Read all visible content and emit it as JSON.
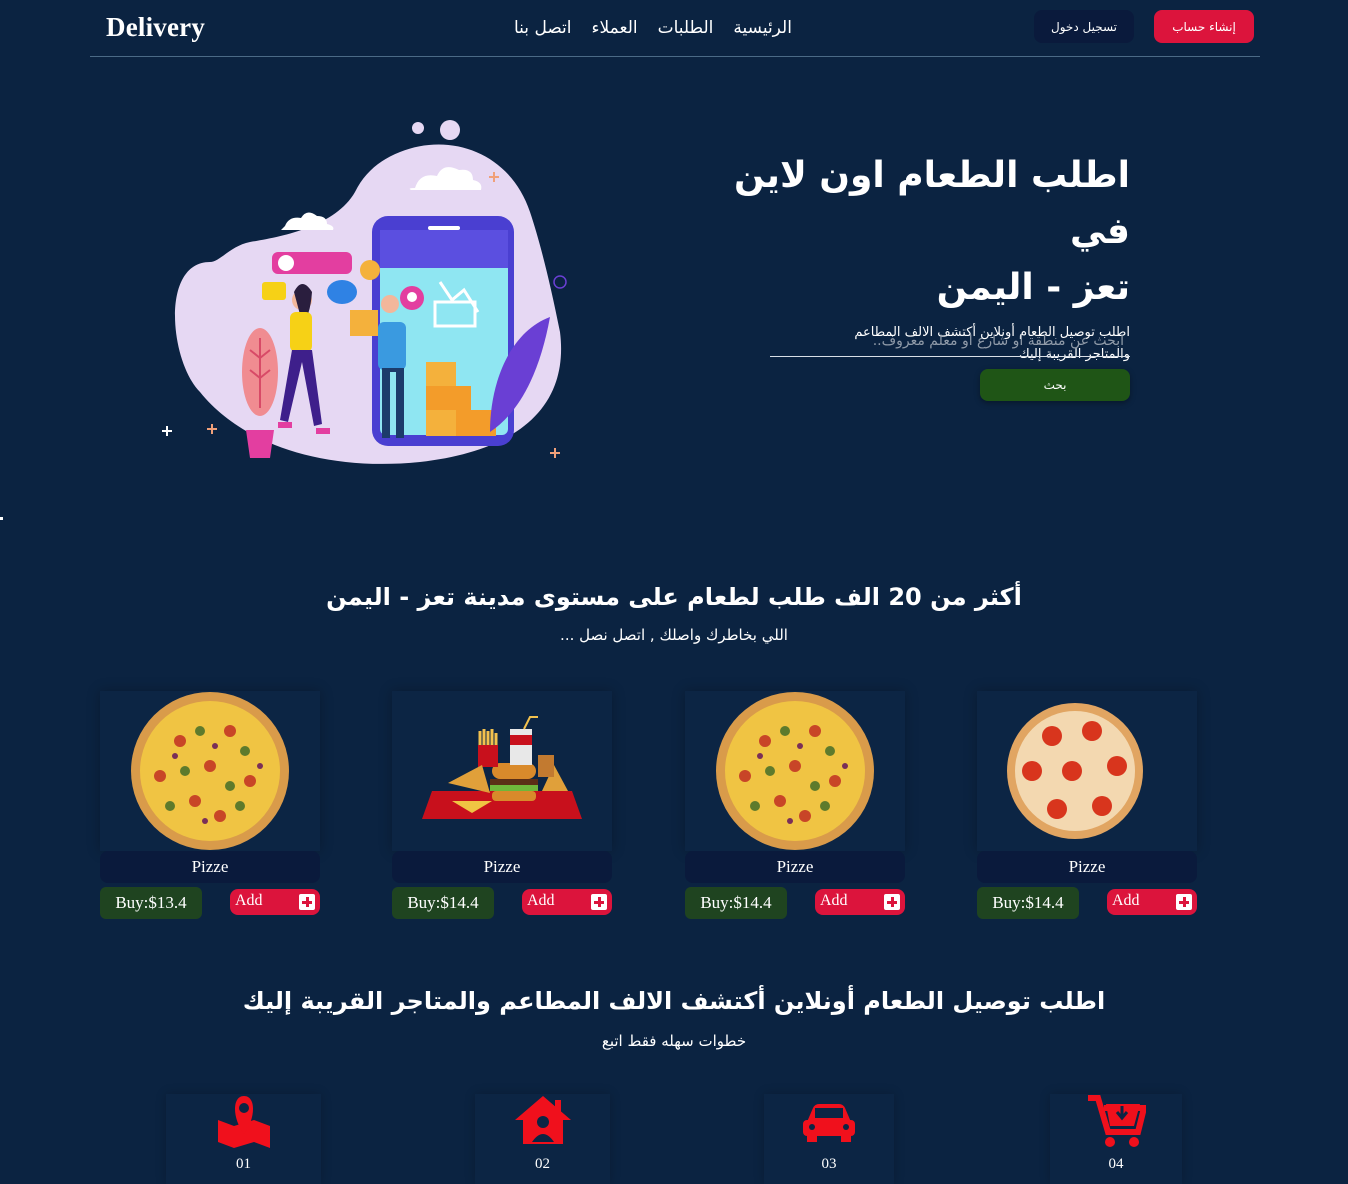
{
  "header": {
    "logo": "Delivery",
    "nav_links": [
      "الرئيسية",
      "الطلبات",
      "العملاء",
      "اتصل بنا"
    ],
    "login_label": "تسجيل دخول",
    "register_label": "إنشاء حساب"
  },
  "hero": {
    "title_line1": "اطلب الطعام اون لاين في",
    "title_line2": "تعز - اليمن",
    "subtitle_line1": "اطلب توصيل الطعام أونلاين أكتشف الالف المطاعم",
    "subtitle_line2": "والمتاجر القريبة إليك",
    "search_placeholder": "ابحث عن منطقة او شارع او معلم معروف..",
    "search_button": "بحث"
  },
  "products_section": {
    "title": "أكثر من 20 الف طلب لطعام على مستوى مدينة تعز - اليمن",
    "subtitle": "اللي بخاطرك واصلك , اتصل نصل ..."
  },
  "products": [
    {
      "name": "Pizze",
      "price": "Buy:$13.4",
      "add_label": "Add",
      "image": "veggie-pizza"
    },
    {
      "name": "Pizze",
      "price": "Buy:$14.4",
      "add_label": "Add",
      "image": "fast-food-tray"
    },
    {
      "name": "Pizze",
      "price": "Buy:$14.4",
      "add_label": "Add",
      "image": "veggie-pizza"
    },
    {
      "name": "Pizze",
      "price": "Buy:$14.4",
      "add_label": "Add",
      "image": "pepperoni-pizza"
    }
  ],
  "steps_section": {
    "title": "اطلب توصيل الطعام أونلاين أكتشف الالف المطاعم والمتاجر القريبة إليك",
    "subtitle": "خطوات سهله فقط اتبع"
  },
  "steps": [
    {
      "number": "01",
      "icon": "map-location-icon"
    },
    {
      "number": "02",
      "icon": "home-user-icon"
    },
    {
      "number": "03",
      "icon": "car-icon"
    },
    {
      "number": "04",
      "icon": "cart-download-icon"
    }
  ],
  "colors": {
    "background": "#0b2341",
    "accent_red": "#dc143c",
    "accent_green": "#1f5516",
    "dark_navy": "#0a1a3c",
    "icon_red": "#f0101c"
  }
}
